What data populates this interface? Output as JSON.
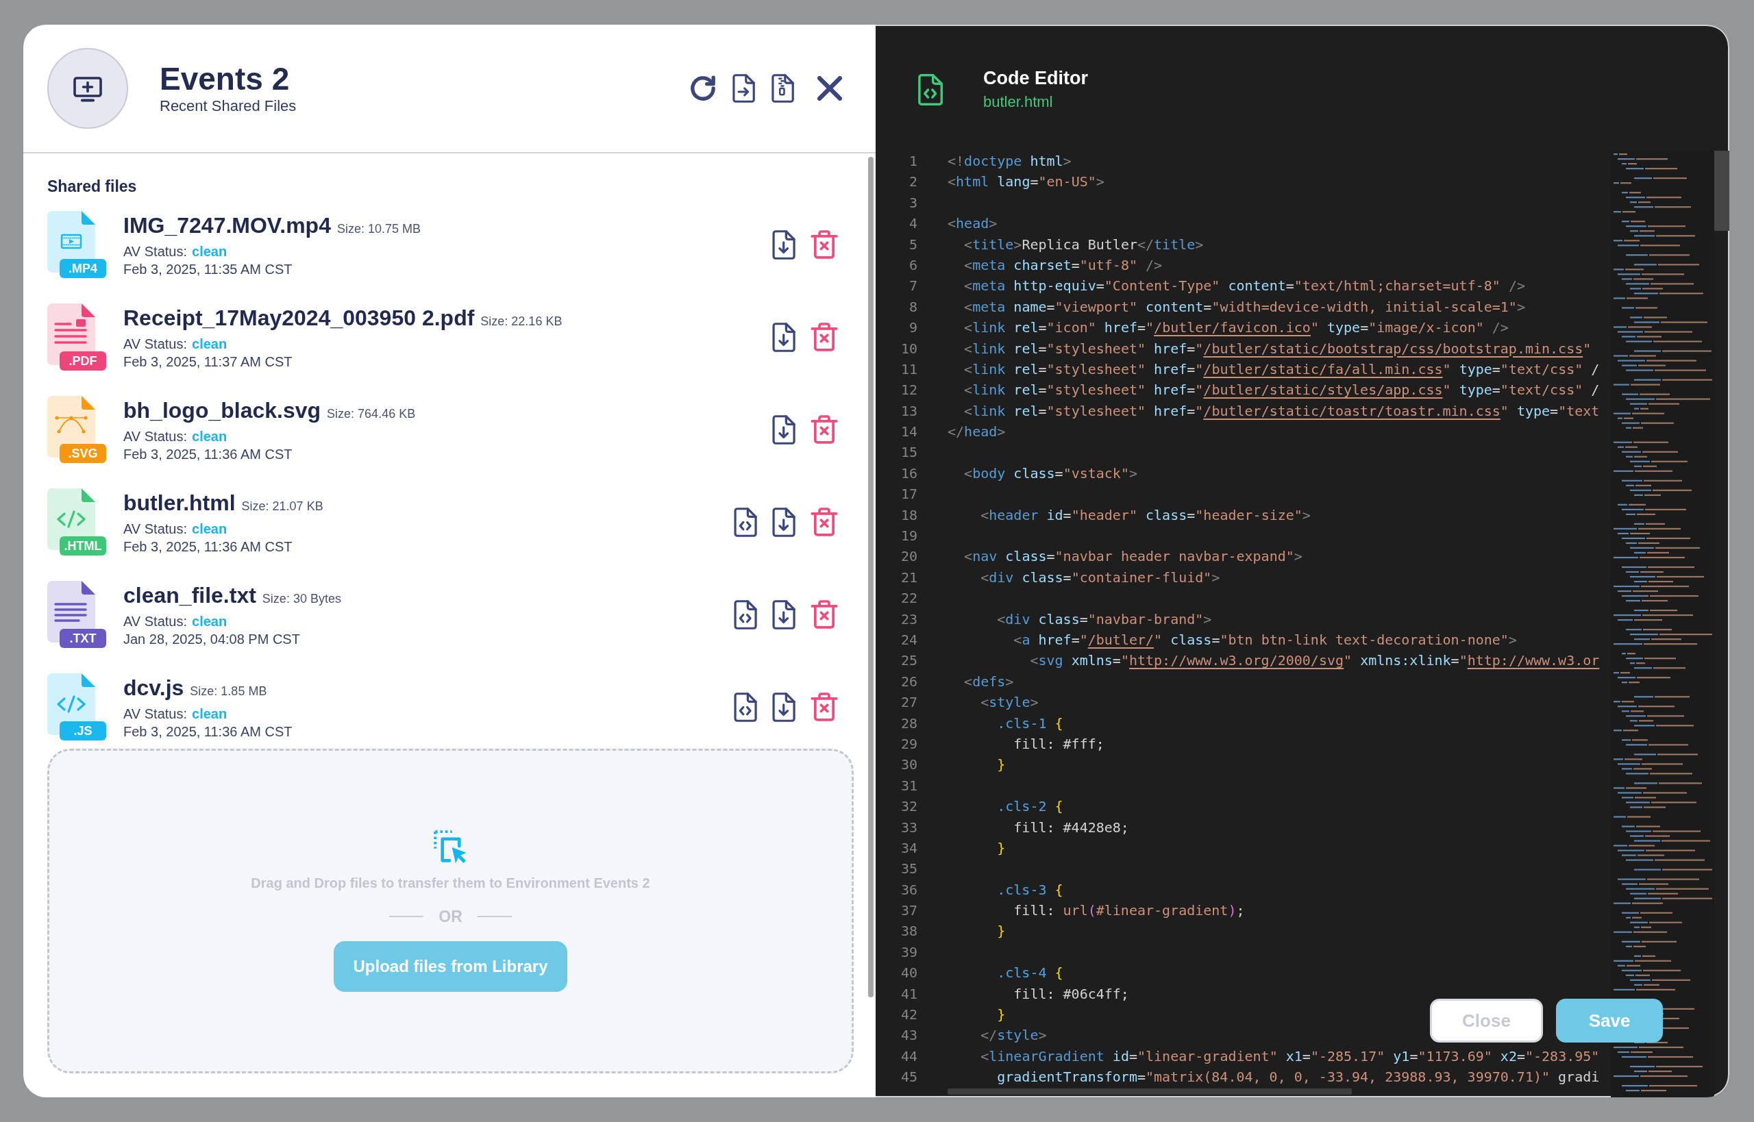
{
  "header": {
    "title": "Events 2",
    "subtitle": "Recent Shared Files"
  },
  "shared_files": {
    "title": "Shared files",
    "files": [
      {
        "kind": "video",
        "color": "#19b9ee",
        "extension": ".MP4",
        "name": "IMG_7247.MOV.mp4",
        "size": "Size: 10.75 MB",
        "av_label": "AV Status:",
        "av_status": "clean",
        "date": "Feb 3, 2025, 11:35 AM CST",
        "code_view": false
      },
      {
        "kind": "pdf",
        "color": "#f0457a",
        "extension": ".PDF",
        "name": "Receipt_17May2024_003950 2.pdf",
        "size": "Size: 22.16 KB",
        "av_label": "AV Status:",
        "av_status": "clean",
        "date": "Feb 3, 2025, 11:37 AM CST",
        "code_view": false
      },
      {
        "kind": "vector",
        "color": "#f5980f",
        "extension": ".SVG",
        "name": "bh_logo_black.svg",
        "size": "Size: 764.46 KB",
        "av_label": "AV Status:",
        "av_status": "clean",
        "date": "Feb 3, 2025, 11:36 AM CST",
        "code_view": false
      },
      {
        "kind": "code",
        "color": "#3cc878",
        "extension": ".HTML",
        "name": "butler.html",
        "size": "Size: 21.07 KB",
        "av_label": "AV Status:",
        "av_status": "clean",
        "date": "Feb 3, 2025, 11:36 AM CST",
        "code_view": true
      },
      {
        "kind": "text",
        "color": "#6a58c2",
        "extension": ".TXT",
        "name": "clean_file.txt",
        "size": "Size: 30 Bytes",
        "av_label": "AV Status:",
        "av_status": "clean",
        "date": "Jan 28, 2025, 04:08 PM CST",
        "code_view": true
      },
      {
        "kind": "code",
        "color": "#19b9ee",
        "extension": ".JS",
        "name": "dcv.js",
        "size": "Size: 1.85 MB",
        "av_label": "AV Status:",
        "av_status": "clean",
        "date": "Feb 3, 2025, 11:36 AM CST",
        "code_view": true
      }
    ]
  },
  "dropzone": {
    "hint": "Drag and Drop files to transfer them to Environment Events 2",
    "separator": "OR",
    "button": "Upload files from Library"
  },
  "editor": {
    "title": "Code Editor",
    "filename": "butler.html",
    "lines": [
      {
        "number": "1",
        "code": "<!doctype html>"
      },
      {
        "number": "2",
        "code": "<html lang=\"en-US\">"
      },
      {
        "number": "3"
      },
      {
        "number": "4",
        "code": "<head>"
      },
      {
        "number": "5",
        "code": "  <title>Replica Butler</title>"
      },
      {
        "number": "6",
        "code": "  <meta charset=\"utf-8\" />"
      },
      {
        "number": "7",
        "code": "  <meta http-equiv=\"Content-Type\" content=\"text/html;charset=utf-8\" />"
      },
      {
        "number": "8",
        "code": "  <meta name=\"viewport\" content=\"width=device-width, initial-scale=1\">"
      },
      {
        "number": "9",
        "code": "  <link rel=\"icon\" href=\"/butler/favicon.ico\" type=\"image/x-icon\" />"
      },
      {
        "number": "10",
        "code": "  <link rel=\"stylesheet\" href=\"/butler/static/bootstrap/css/bootstrap.min.css\""
      },
      {
        "number": "11",
        "code": "  <link rel=\"stylesheet\" href=\"/butler/static/fa/all.min.css\" type=\"text/css\" /"
      },
      {
        "number": "12",
        "code": "  <link rel=\"stylesheet\" href=\"/butler/static/styles/app.css\" type=\"text/css\" /"
      },
      {
        "number": "13",
        "code": "  <link rel=\"stylesheet\" href=\"/butler/static/toastr/toastr.min.css\" type=\"text"
      },
      {
        "number": "14",
        "code": "</head>"
      },
      {
        "number": "15"
      },
      {
        "number": "16",
        "code": "  <body class=\"vstack\">"
      },
      {
        "number": "17"
      },
      {
        "number": "18",
        "code": "    <header id=\"header\" class=\"header-size\">"
      },
      {
        "number": "19"
      },
      {
        "number": "20",
        "code": "  <nav class=\"navbar header navbar-expand\">"
      },
      {
        "number": "21",
        "code": "    <div class=\"container-fluid\">"
      },
      {
        "number": "22"
      },
      {
        "number": "23",
        "code": "      <div class=\"navbar-brand\">"
      },
      {
        "number": "24",
        "code": "        <a href=\"/butler/\" class=\"btn btn-link text-decoration-none\">"
      },
      {
        "number": "25",
        "code": "          <svg xmlns=\"http://www.w3.org/2000/svg\" xmlns:xlink=\"http://www.w3.or"
      },
      {
        "number": "26",
        "code": "  <defs>"
      },
      {
        "number": "27",
        "code": "    <style>"
      },
      {
        "number": "28",
        "code": "      .cls-1 {"
      },
      {
        "number": "29",
        "code": "        fill: #fff;"
      },
      {
        "number": "30",
        "code": "      }"
      },
      {
        "number": "31"
      },
      {
        "number": "32",
        "code": "      .cls-2 {"
      },
      {
        "number": "33",
        "code": "        fill: #4428e8;"
      },
      {
        "number": "34",
        "code": "      }"
      },
      {
        "number": "35"
      },
      {
        "number": "36",
        "code": "      .cls-3 {"
      },
      {
        "number": "37",
        "code": "        fill: url(#linear-gradient);"
      },
      {
        "number": "38",
        "code": "      }"
      },
      {
        "number": "39"
      },
      {
        "number": "40",
        "code": "      .cls-4 {"
      },
      {
        "number": "41",
        "code": "        fill: #06c4ff;"
      },
      {
        "number": "42",
        "code": "      }"
      },
      {
        "number": "43",
        "code": "    </style>"
      },
      {
        "number": "44",
        "code": "    <linearGradient id=\"linear-gradient\" x1=\"-285.17\" y1=\"1173.69\" x2=\"-283.95\""
      },
      {
        "number": "45",
        "code": "      gradientTransform=\"matrix(84.04, 0, 0, -33.94, 23988.93, 39970.71)\" gradi"
      }
    ],
    "buttons": [
      {
        "kind": "secondary",
        "label": "Close"
      },
      {
        "kind": "primary",
        "label": "Save"
      }
    ]
  }
}
